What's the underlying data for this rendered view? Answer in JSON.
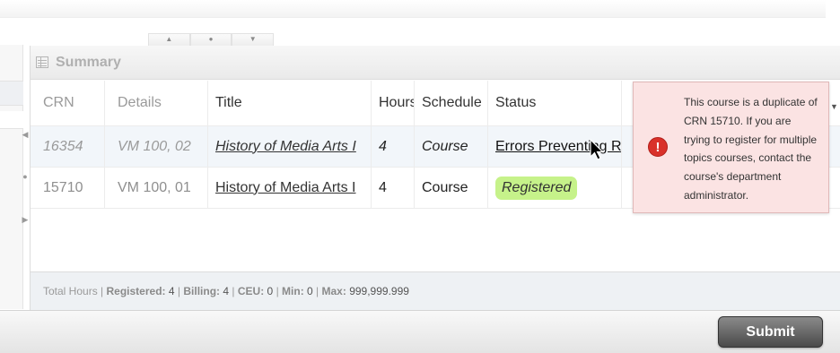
{
  "panel": {
    "title": "Summary"
  },
  "columns": [
    "CRN",
    "Details",
    "Title",
    "Hours",
    "Schedule",
    "Status"
  ],
  "rows": [
    {
      "crn": "16354",
      "details": "VM 100, 02",
      "title": "History of Media Arts I",
      "hours": "4",
      "schedule": "Course",
      "status": "Errors Preventing Registration"
    },
    {
      "crn": "15710",
      "details": "VM 100, 01",
      "title": "History of Media Arts I",
      "hours": "4",
      "schedule": "Course",
      "status": "Registered"
    }
  ],
  "footer": {
    "total_hours": "Total Hours",
    "registered_label": "Registered:",
    "registered_value": "4",
    "billing_label": "Billing:",
    "billing_value": "4",
    "ceu_label": "CEU:",
    "ceu_value": "0",
    "min_label": "Min:",
    "min_value": "0",
    "max_label": "Max:",
    "max_value": "999,999.999"
  },
  "tooltip": {
    "message": "This course is a duplicate of CRN 15710. If you are trying to register for multiple topics courses, contact the course's department administrator."
  },
  "submit_label": "Submit",
  "colors": {
    "badge": "#c6f28a",
    "error": "#d9312a",
    "tooltip_bg": "#fbe3e3"
  }
}
